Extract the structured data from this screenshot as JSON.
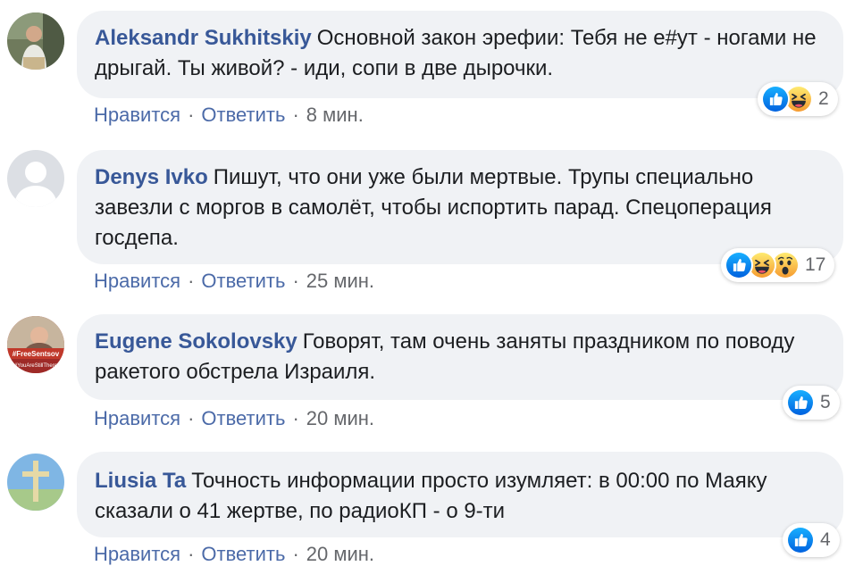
{
  "actions": {
    "like_label": "Нравится",
    "reply_label": "Ответить",
    "separator": "·"
  },
  "comments": [
    {
      "author": "Aleksandr Sukhitskiy",
      "text": "Основной закон эрефии: Тебя не е#ут - ногами не дрыгай. Ты живой? - иди, сопи в две дырочки.",
      "time": "8 мин.",
      "reactions": [
        "like-icon",
        "haha-icon"
      ],
      "reaction_count": "2"
    },
    {
      "author": "Denys Ivko",
      "text": "Пишут, что они уже были мертвые. Трупы специально завезли с моргов в самолёт, чтобы испортить парад. Спецоперация госдепа.",
      "time": "25 мин.",
      "reactions": [
        "like-icon",
        "haha-icon",
        "wow-icon"
      ],
      "reaction_count": "17"
    },
    {
      "author": "Eugene Sokolovsky",
      "text": "Говорят, там очень заняты праздником по поводу ракетого обстрела Израиля.",
      "time": "20 мин.",
      "reactions": [
        "like-icon"
      ],
      "reaction_count": "5",
      "avatar_banner_top": "#FreeSentsov",
      "avatar_banner_bottom": "#YouAreStillThere"
    },
    {
      "author": "Liusia Ta",
      "text": "Точность информации просто изумляет: в 00:00 по Маяку сказали о 41 жертве, по радиоКП - о 9-ти",
      "time": "20 мин.",
      "reactions": [
        "like-icon"
      ],
      "reaction_count": "4"
    }
  ],
  "colors": {
    "author": "#385898",
    "bubble": "#f0f2f5",
    "action_link": "#4b6aa8",
    "like_blue": "#1877f2",
    "haha_yellow": "#f7b125"
  }
}
